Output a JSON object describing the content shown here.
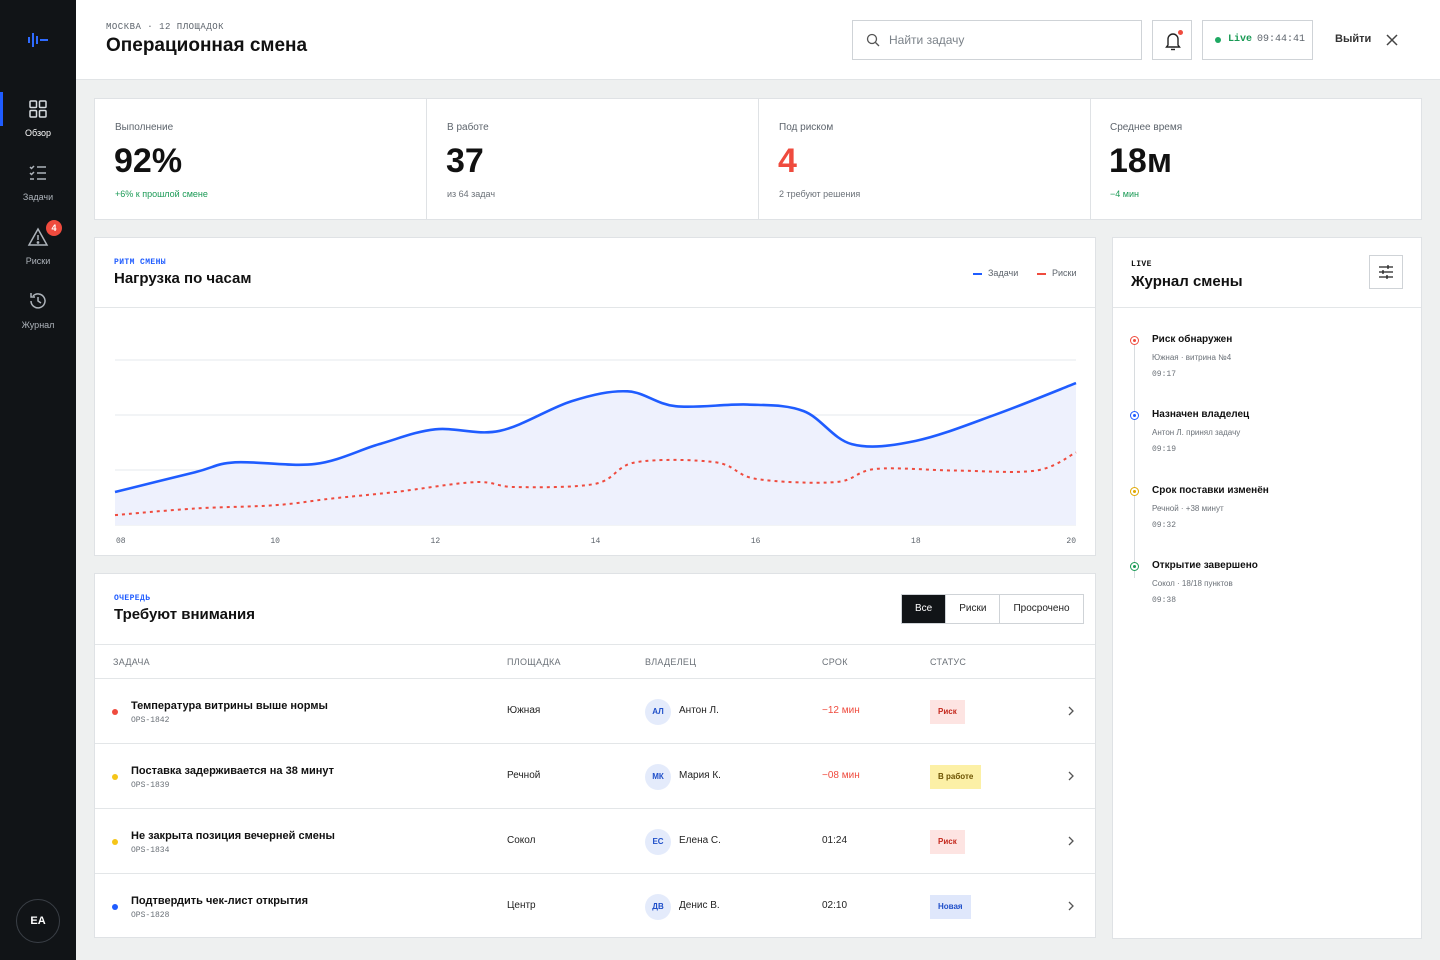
{
  "sidebar": {
    "items": [
      {
        "label": "Обзор",
        "icon": "grid-icon",
        "active": true
      },
      {
        "label": "Задачи",
        "icon": "checklist-icon"
      },
      {
        "label": "Риски",
        "icon": "warning-icon",
        "badge": "4"
      },
      {
        "label": "Журнал",
        "icon": "history-icon"
      }
    ],
    "user_initials": "EA"
  },
  "header": {
    "crumb": "МОСКВА · 12 ПЛОЩАДОК",
    "title": "Операционная смена",
    "search_placeholder": "Найти задачу",
    "live_label": "Live",
    "live_time": "09:44:41",
    "logout_label": "Выйти"
  },
  "kpis": [
    {
      "label": "Выполнение",
      "value": "92%",
      "sub": "+6% к прошлой смене",
      "value_color": "default",
      "sub_color": "green"
    },
    {
      "label": "В работе",
      "value": "37",
      "sub": "из 64 задач",
      "value_color": "default",
      "sub_color": "default"
    },
    {
      "label": "Под риском",
      "value": "4",
      "sub": "2 требуют решения",
      "value_color": "red",
      "sub_color": "default"
    },
    {
      "label": "Среднее время",
      "value": "18м",
      "sub": "−4 мин",
      "value_color": "default",
      "sub_color": "green"
    }
  ],
  "load_chart": {
    "eyebrow": "РИТМ СМЕНЫ",
    "title": "Нагрузка по часам",
    "legend_tasks": "Задачи",
    "legend_risks": "Риски"
  },
  "chart_data": {
    "type": "line",
    "title": "Нагрузка по часам",
    "x_ticks": [
      "08",
      "10",
      "12",
      "14",
      "16",
      "18",
      "20"
    ],
    "xlim": [
      8,
      20
    ],
    "ylim": [
      0,
      100
    ],
    "grid": true,
    "legend": "top-right",
    "colors": {
      "tasks": "#1f5cff",
      "risks": "#ef4b3e"
    },
    "series": [
      {
        "name": "Задачи",
        "x": [
          8,
          9,
          9.5,
          10.5,
          11.3,
          12,
          12.8,
          13.7,
          14.4,
          15,
          15.9,
          16.6,
          17.2,
          18,
          19,
          20
        ],
        "y": [
          20,
          32,
          38,
          37,
          49,
          58,
          57,
          75,
          81,
          72,
          73,
          69,
          49,
          51,
          67,
          86
        ]
      },
      {
        "name": "Риски",
        "x": [
          8,
          9,
          10,
          10.7,
          11.5,
          12.5,
          13,
          14,
          14.5,
          15.5,
          16,
          17,
          17.5,
          18.5,
          19.5,
          20
        ],
        "y": [
          6,
          10,
          12,
          16,
          20,
          26,
          23,
          25,
          38,
          38,
          28,
          26,
          34,
          33,
          33,
          44
        ]
      }
    ]
  },
  "queue": {
    "eyebrow": "ОЧЕРЕДЬ",
    "title": "Требуют внимания",
    "filters": [
      "Все",
      "Риски",
      "Просрочено"
    ],
    "columns": {
      "task": "ЗАДАЧА",
      "site": "ПЛОЩАДКА",
      "owner": "ВЛАДЕЛЕЦ",
      "due": "СРОК",
      "status": "СТАТУС"
    },
    "rows": [
      {
        "title": "Температура витрины выше нормы",
        "code": "OPS-1842",
        "site": "Южная",
        "initials": "АЛ",
        "owner": "Антон Л.",
        "due": "−12 мин",
        "late": true,
        "status": "Риск",
        "status_kind": "risk",
        "bullet": "#ef4b3e"
      },
      {
        "title": "Поставка задерживается на 38 минут",
        "code": "OPS-1839",
        "site": "Речной",
        "initials": "МК",
        "owner": "Мария К.",
        "due": "−08 мин",
        "late": true,
        "status": "В работе",
        "status_kind": "work",
        "bullet": "#f5c518"
      },
      {
        "title": "Не закрыта позиция вечерней смены",
        "code": "OPS-1834",
        "site": "Сокол",
        "initials": "ЕС",
        "owner": "Елена С.",
        "due": "01:24",
        "late": false,
        "status": "Риск",
        "status_kind": "risk",
        "bullet": "#f5c518"
      },
      {
        "title": "Подтвердить чек-лист открытия",
        "code": "OPS-1828",
        "site": "Центр",
        "initials": "ДВ",
        "owner": "Денис В.",
        "due": "02:10",
        "late": false,
        "status": "Новая",
        "status_kind": "new",
        "bullet": "#1f5cff"
      }
    ]
  },
  "log": {
    "eyebrow": "LIVE",
    "title": "Журнал смены",
    "events": [
      {
        "title": "Риск обнаружен",
        "desc": "Южная · витрина №4",
        "time": "09:17",
        "color": "#ef4b3e"
      },
      {
        "title": "Назначен владелец",
        "desc": "Антон Л. принял задачу",
        "time": "09:19",
        "color": "#1f5cff"
      },
      {
        "title": "Срок поставки изменён",
        "desc": "Речной · +38 минут",
        "time": "09:32",
        "color": "#e0a800"
      },
      {
        "title": "Открытие завершено",
        "desc": "Сокол · 18/18 пунктов",
        "time": "09:38",
        "color": "#1a9a55"
      }
    ]
  }
}
